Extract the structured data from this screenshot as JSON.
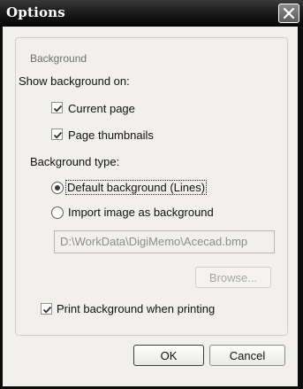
{
  "dialog": {
    "title": "Options"
  },
  "background_group": {
    "legend": "Background",
    "show_on_label": "Show background on:",
    "current_page": {
      "label": "Current page",
      "checked": true
    },
    "page_thumbnails": {
      "label": "Page thumbnails",
      "checked": true
    },
    "type_label": "Background type:",
    "default_bg": {
      "label": "Default background (Lines)",
      "selected": true
    },
    "import_bg": {
      "label": "Import image as background",
      "selected": false
    },
    "image_path": "D:\\WorkData\\DigiMemo\\Acecad.bmp",
    "browse_label": "Browse...",
    "print_bg": {
      "label": "Print background when printing",
      "checked": true
    }
  },
  "buttons": {
    "ok_label": "OK",
    "cancel_label": "Cancel"
  },
  "colors": {
    "titlebar": "#0b0b0b",
    "client_bg": "#f1f0ec"
  },
  "icons": {
    "close": "close-icon",
    "checkmark": "checkmark-icon"
  }
}
